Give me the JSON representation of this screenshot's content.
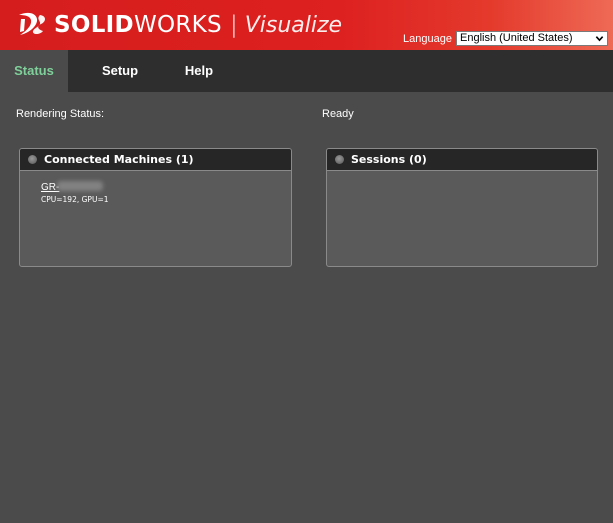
{
  "header": {
    "brand_bold": "SOLID",
    "brand_light": "WORKS",
    "brand_separator": "|",
    "brand_product": "Visualize",
    "language_label": "Language",
    "language_selected": "English (United States)"
  },
  "nav": {
    "tabs": [
      {
        "label": "Status",
        "active": true
      },
      {
        "label": "Setup",
        "active": false
      },
      {
        "label": "Help",
        "active": false
      }
    ]
  },
  "status": {
    "label": "Rendering Status:",
    "value": "Ready"
  },
  "panels": {
    "machines": {
      "title": "Connected Machines (1)",
      "items": [
        {
          "name": "GR-",
          "specs": "CPU=192, GPU=1"
        }
      ]
    },
    "sessions": {
      "title": "Sessions (0)"
    }
  },
  "colors": {
    "header_red": "#dd2020",
    "nav_bg": "#2e2e2e",
    "active_tab_text": "#7fd09a",
    "page_bg": "#4b4b4b"
  },
  "icons": {
    "logo": "ds-logo-icon",
    "language_caret": "chevron-down-icon",
    "panel_bullet": "circle-bullet-icon"
  }
}
